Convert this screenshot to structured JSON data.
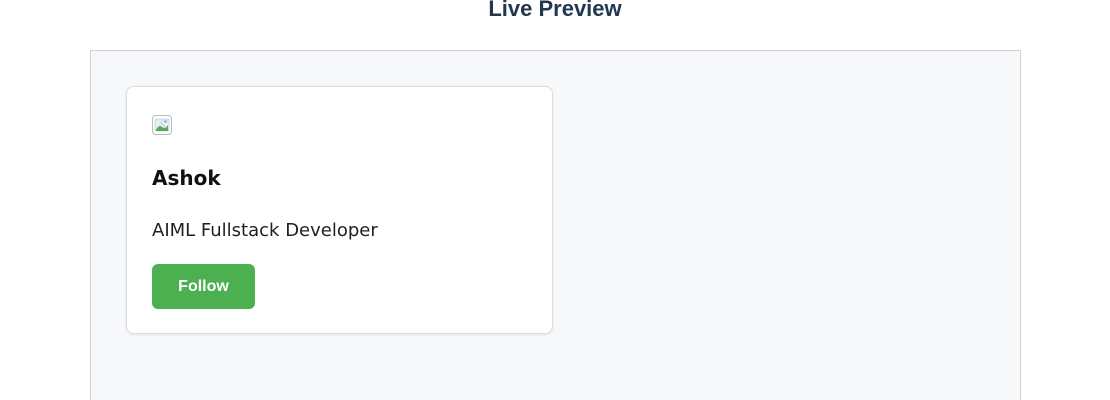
{
  "header": {
    "title": "Live Preview"
  },
  "card": {
    "name": "Ashok",
    "role": "AIML Fullstack Developer",
    "follow_label": "Follow",
    "avatar_icon": "broken-image-icon"
  },
  "colors": {
    "title_text": "#22384f",
    "preview_background": "#f7f8fa",
    "button_background": "#4caf50",
    "button_text": "#ffffff"
  }
}
